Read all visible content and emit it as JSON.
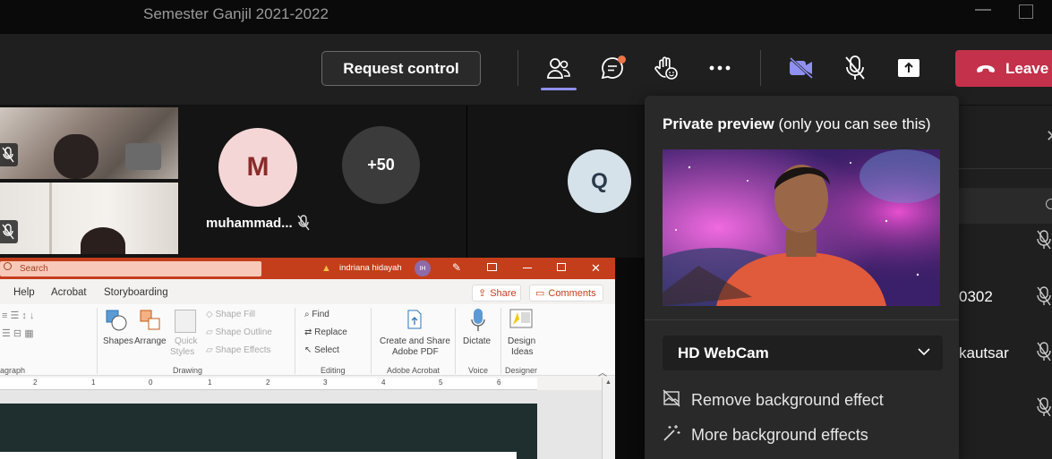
{
  "window": {
    "title": "Semester Ganjil 2021-2022"
  },
  "toolbar": {
    "request_control": "Request control",
    "leave": "Leave",
    "icons": [
      "people-icon",
      "chat-icon",
      "raise-hand-icon",
      "more-icon",
      "camera-off-icon",
      "mic-off-icon",
      "share-tray-icon",
      "phone-hangup-icon"
    ]
  },
  "participants": {
    "avatar_m": {
      "initial": "M",
      "name": "muhammad...",
      "color": "#f5d6d6",
      "text_color": "#8a2b2b"
    },
    "overflow": "+50",
    "avatar_q": {
      "initial": "Q",
      "color": "#d6e2ea",
      "text_color": "#2a3a4a"
    }
  },
  "powerpoint": {
    "search_placeholder": "Search",
    "user_name": "indriana hidayah",
    "user_initials": "IH",
    "tabs": [
      "Help",
      "Acrobat",
      "Storyboarding"
    ],
    "share": "Share",
    "comments": "Comments",
    "ribbon": {
      "paragraph_label": "agraph",
      "shapes": "Shapes",
      "arrange": "Arrange",
      "quick_styles_1": "Quick",
      "quick_styles_2": "Styles",
      "shape_fill": "Shape Fill",
      "shape_outline": "Shape Outline",
      "shape_effects": "Shape Effects",
      "drawing_label": "Drawing",
      "find": "Find",
      "replace": "Replace",
      "select": "Select",
      "editing_label": "Editing",
      "create_share_1": "Create and Share",
      "create_share_2": "Adobe PDF",
      "adobe_label": "Adobe Acrobat",
      "dictate": "Dictate",
      "voice_label": "Voice",
      "design_ideas_1": "Design",
      "design_ideas_2": "Ideas",
      "designer_label": "Designer"
    },
    "ruler": [
      "2",
      "1",
      "1",
      "0",
      "1",
      "2",
      "3",
      "4",
      "5",
      "6"
    ]
  },
  "right_pane": {
    "rows": [
      "0302",
      "kautsar"
    ]
  },
  "preview": {
    "heading_bold": "Private preview",
    "heading_rest": " (only you can see this)",
    "camera": "HD WebCam",
    "remove_bg": "Remove background effect",
    "more_bg": "More background effects"
  },
  "colors": {
    "accent": "#8f90f0",
    "leave": "#c4314b",
    "ppt": "#c43e1c"
  }
}
